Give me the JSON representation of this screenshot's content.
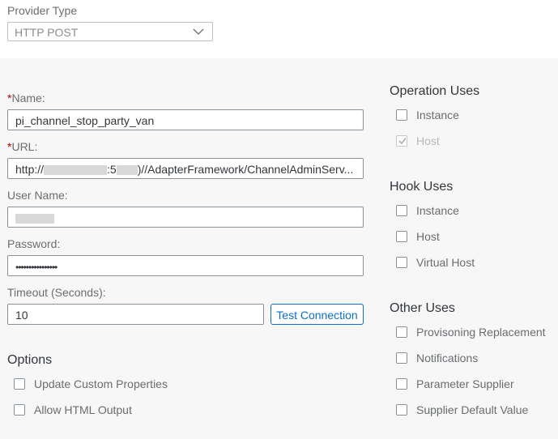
{
  "provider": {
    "label": "Provider Type",
    "value": "HTTP POST"
  },
  "form": {
    "name_label": "Name:",
    "name_value": "pi_channel_stop_party_van",
    "url_label": "URL:",
    "url_prefix": "http://",
    "url_mid": ":5",
    "url_suffix": ")//AdapterFramework/ChannelAdminServ...",
    "username_label": "User Name:",
    "password_label": "Password:",
    "password_value": "••••••••••••••••",
    "timeout_label": "Timeout (Seconds):",
    "timeout_value": "10",
    "required_marker": "*",
    "test_connection": "Test Connection"
  },
  "options": {
    "title": "Options",
    "items": [
      {
        "label": "Update Custom Properties",
        "checked": false
      },
      {
        "label": "Allow HTML Output",
        "checked": false
      }
    ]
  },
  "operation_uses": {
    "title": "Operation Uses",
    "items": [
      {
        "label": "Instance",
        "checked": false,
        "disabled": false
      },
      {
        "label": "Host",
        "checked": true,
        "disabled": true
      }
    ]
  },
  "hook_uses": {
    "title": "Hook Uses",
    "items": [
      {
        "label": "Instance",
        "checked": false
      },
      {
        "label": "Host",
        "checked": false
      },
      {
        "label": "Virtual Host",
        "checked": false
      }
    ]
  },
  "other_uses": {
    "title": "Other Uses",
    "items": [
      {
        "label": "Provisoning Replacement",
        "checked": false
      },
      {
        "label": "Notifications",
        "checked": false
      },
      {
        "label": "Parameter Supplier",
        "checked": false
      },
      {
        "label": "Supplier Default Value",
        "checked": false
      }
    ]
  },
  "icons": {
    "select_chevron": "chevron-down-icon",
    "checkmark": "checkmark-icon"
  },
  "colors": {
    "accent": "#0a6ed1",
    "required": "#bb0000",
    "panel_bg": "#f7f7f7"
  }
}
